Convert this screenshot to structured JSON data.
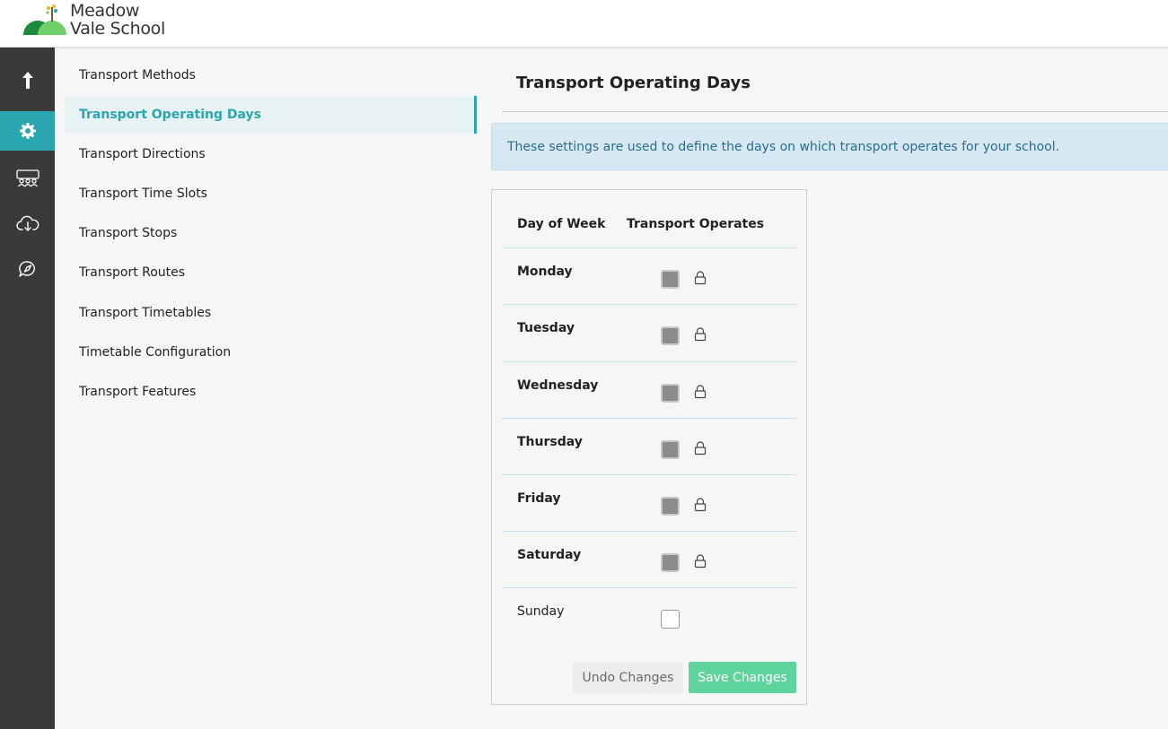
{
  "brand": {
    "name_line1": "Meadow",
    "name_line2": "Vale School",
    "accent": "#2aa6b1"
  },
  "rail": {
    "items": [
      {
        "icon": "upload-arrow-icon",
        "active": false
      },
      {
        "icon": "gear-icon",
        "active": true
      },
      {
        "icon": "people-group-icon",
        "active": false
      },
      {
        "icon": "cloud-download-icon",
        "active": false
      },
      {
        "icon": "compass-chat-icon",
        "active": false
      }
    ]
  },
  "subnav": {
    "items": [
      {
        "label": "Transport Methods",
        "active": false
      },
      {
        "label": "Transport Operating Days",
        "active": true
      },
      {
        "label": "Transport Directions",
        "active": false
      },
      {
        "label": "Transport Time Slots",
        "active": false
      },
      {
        "label": "Transport Stops",
        "active": false
      },
      {
        "label": "Transport Routes",
        "active": false
      },
      {
        "label": "Transport Timetables",
        "active": false
      },
      {
        "label": "Timetable Configuration",
        "active": false
      },
      {
        "label": "Transport Features",
        "active": false
      }
    ]
  },
  "main": {
    "title": "Transport Operating Days",
    "info": "These settings are used to define the days on which transport operates for your school.",
    "table": {
      "col_day": "Day of Week",
      "col_operates": "Transport Operates",
      "rows": [
        {
          "day": "Monday",
          "operates": true,
          "locked": true
        },
        {
          "day": "Tuesday",
          "operates": true,
          "locked": true
        },
        {
          "day": "Wednesday",
          "operates": true,
          "locked": true
        },
        {
          "day": "Thursday",
          "operates": true,
          "locked": true
        },
        {
          "day": "Friday",
          "operates": true,
          "locked": true
        },
        {
          "day": "Saturday",
          "operates": true,
          "locked": true
        },
        {
          "day": "Sunday",
          "operates": false,
          "locked": false
        }
      ]
    },
    "undo_label": "Undo Changes",
    "save_label": "Save Changes"
  }
}
